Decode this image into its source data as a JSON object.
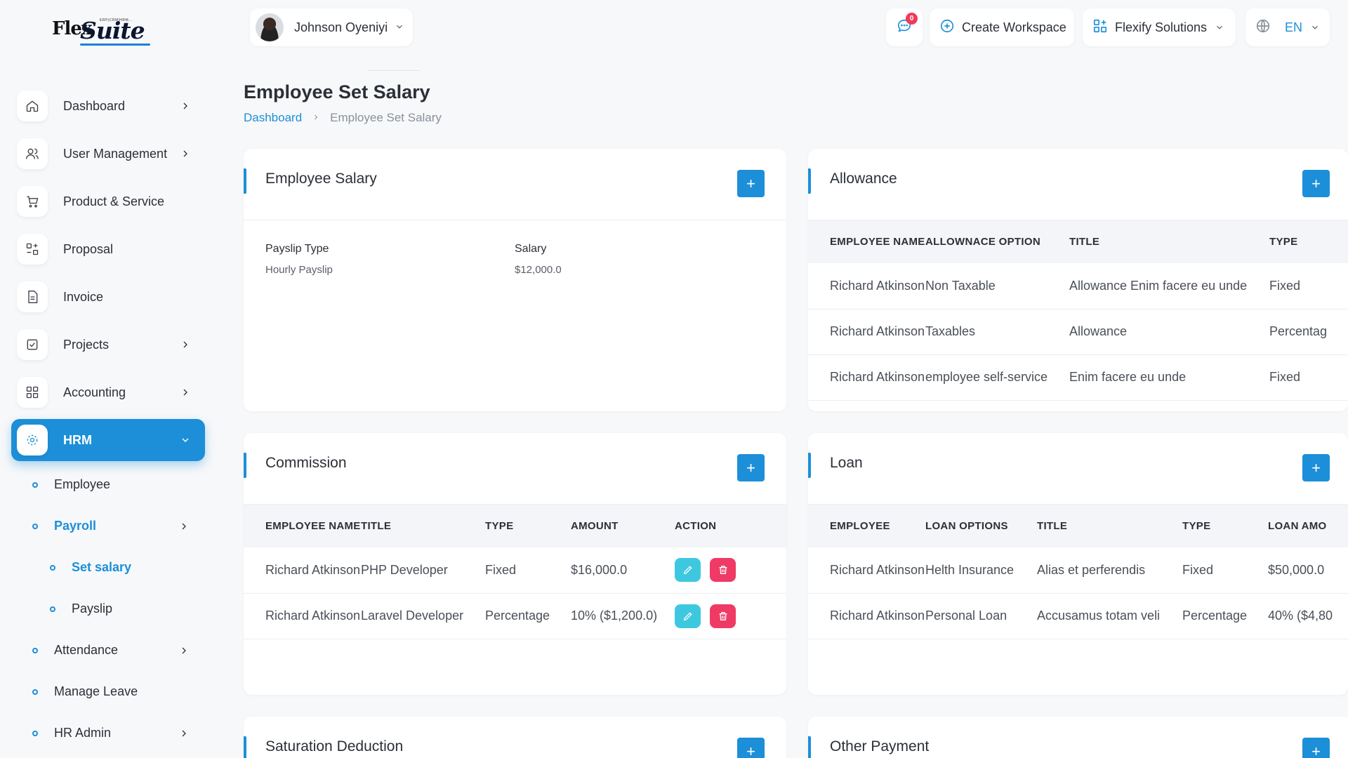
{
  "logo": {
    "brand_part1": "Flex",
    "brand_part2": "Suite",
    "tagline": "ERP|CRM|HRM..."
  },
  "sidebar": {
    "items": [
      {
        "label": "Dashboard",
        "icon": "home-icon",
        "has_chevron": true
      },
      {
        "label": "User Management",
        "icon": "users-icon",
        "has_chevron": true
      },
      {
        "label": "Product & Service",
        "icon": "cart-icon",
        "has_chevron": false
      },
      {
        "label": "Proposal",
        "icon": "proposal-icon",
        "has_chevron": false
      },
      {
        "label": "Invoice",
        "icon": "file-icon",
        "has_chevron": false
      },
      {
        "label": "Projects",
        "icon": "check-square-icon",
        "has_chevron": true
      },
      {
        "label": "Accounting",
        "icon": "grid-icon",
        "has_chevron": true
      },
      {
        "label": "HRM",
        "icon": "hrm-icon",
        "has_chevron": true,
        "active": true
      }
    ],
    "sub_items": [
      {
        "label": "Employee"
      },
      {
        "label": "Payroll",
        "active": true
      },
      {
        "label": "Set salary",
        "active": true
      },
      {
        "label": "Payslip"
      },
      {
        "label": "Attendance"
      },
      {
        "label": "Manage Leave"
      },
      {
        "label": "HR Admin"
      }
    ]
  },
  "topbar": {
    "user_name": "Johnson Oyeniyi",
    "message_count": "0",
    "create_workspace": "Create Workspace",
    "workspace_name": "Flexify Solutions",
    "language": "EN"
  },
  "page": {
    "title": "Employee Set Salary",
    "breadcrumb": {
      "home": "Dashboard",
      "current": "Employee Set Salary"
    }
  },
  "employee_salary": {
    "title": "Employee Salary",
    "add_label": "+",
    "payslip_type_label": "Payslip Type",
    "payslip_type_value": "Hourly Payslip",
    "salary_label": "Salary",
    "salary_value": "$12,000.0"
  },
  "allowance": {
    "title": "Allowance",
    "add_label": "+",
    "headers": [
      "EMPLOYEE NAME",
      "ALLOWNACE OPTION",
      "TITLE",
      "TYPE"
    ],
    "rows": [
      [
        "Richard Atkinson",
        "Non Taxable",
        "Allowance Enim facere eu unde",
        "Fixed"
      ],
      [
        "Richard Atkinson",
        "Taxables",
        "Allowance",
        "Percentag"
      ],
      [
        "Richard Atkinson",
        "employee self-service",
        "Enim facere eu unde",
        "Fixed"
      ]
    ]
  },
  "commission": {
    "title": "Commission",
    "add_label": "+",
    "headers": [
      "EMPLOYEE NAME",
      "TITLE",
      "TYPE",
      "AMOUNT",
      "ACTION"
    ],
    "rows": [
      [
        "Richard Atkinson",
        "PHP Developer",
        "Fixed",
        "$16,000.0"
      ],
      [
        "Richard Atkinson",
        "Laravel Developer",
        "Percentage",
        "10% ($1,200.0)"
      ]
    ]
  },
  "loan": {
    "title": "Loan",
    "add_label": "+",
    "headers": [
      "EMPLOYEE",
      "LOAN OPTIONS",
      "TITLE",
      "TYPE",
      "LOAN AMO"
    ],
    "rows": [
      [
        "Richard Atkinson",
        "Helth Insurance",
        "Alias et perferendis",
        "Fixed",
        "$50,000.0"
      ],
      [
        "Richard Atkinson",
        "Personal Loan",
        "Accusamus totam veli",
        "Percentage",
        "40% ($4,80"
      ]
    ]
  },
  "saturation_deduction": {
    "title": "Saturation Deduction",
    "add_label": "+"
  },
  "other_payment": {
    "title": "Other Payment",
    "add_label": "+"
  },
  "colors": {
    "accent": "#1c8fd8",
    "edit": "#3ec8e0",
    "delete": "#f03a66",
    "badge": "#ef3b5a"
  }
}
